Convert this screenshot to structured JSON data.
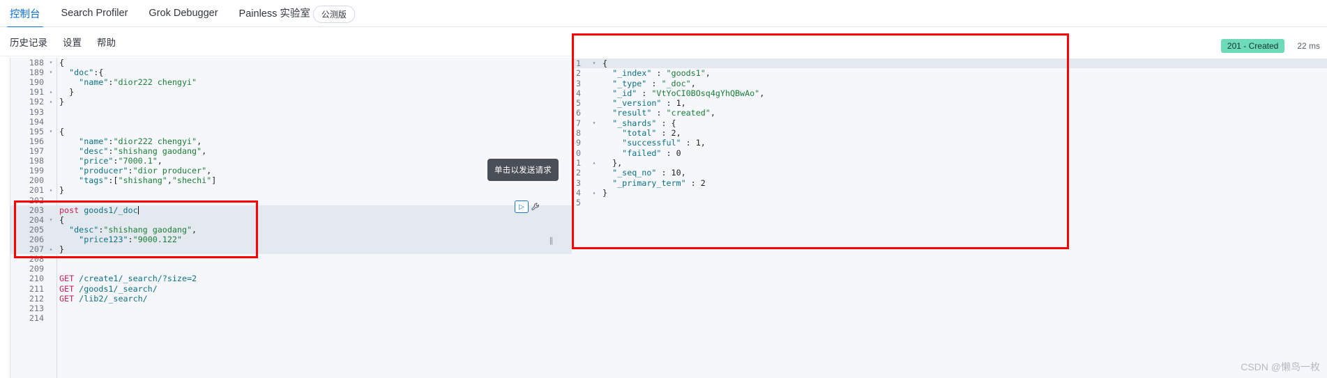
{
  "topbar": {
    "tabs": [
      {
        "label": "控制台",
        "active": true
      },
      {
        "label": "Search Profiler",
        "active": false
      },
      {
        "label": "Grok Debugger",
        "active": false
      },
      {
        "label": "Painless 实验室",
        "active": false
      }
    ],
    "beta_badge": "公测版"
  },
  "submenu": {
    "items": [
      {
        "label": "历史记录"
      },
      {
        "label": "设置"
      },
      {
        "label": "帮助"
      }
    ]
  },
  "editor": {
    "lines": [
      {
        "n": "188",
        "fold": "▾",
        "error": false,
        "hl": false,
        "text": "{"
      },
      {
        "n": "189",
        "fold": "▾",
        "error": false,
        "hl": false,
        "text": "  \"doc\":{"
      },
      {
        "n": "190",
        "fold": "",
        "error": false,
        "hl": false,
        "text": "    \"name\":\"dior222 chengyi\""
      },
      {
        "n": "191",
        "fold": "▴",
        "error": false,
        "hl": false,
        "text": "  }"
      },
      {
        "n": "192",
        "fold": "▴",
        "error": false,
        "hl": false,
        "text": "}"
      },
      {
        "n": "193",
        "fold": "",
        "error": false,
        "hl": false,
        "text": ""
      },
      {
        "n": "194",
        "fold": "",
        "error": false,
        "hl": false,
        "text": ""
      },
      {
        "n": "195",
        "fold": "▾",
        "error": true,
        "hl": false,
        "text": "{"
      },
      {
        "n": "196",
        "fold": "",
        "error": false,
        "hl": false,
        "text": "    \"name\":\"dior222 chengyi\","
      },
      {
        "n": "197",
        "fold": "",
        "error": false,
        "hl": false,
        "text": "    \"desc\":\"shishang gaodang\","
      },
      {
        "n": "198",
        "fold": "",
        "error": false,
        "hl": false,
        "text": "    \"price\":\"7000.1\","
      },
      {
        "n": "199",
        "fold": "",
        "error": false,
        "hl": false,
        "text": "    \"producer\":\"dior producer\","
      },
      {
        "n": "200",
        "fold": "",
        "error": false,
        "hl": false,
        "text": "    \"tags\":[\"shishang\",\"shechi\"]"
      },
      {
        "n": "201",
        "fold": "▴",
        "error": false,
        "hl": false,
        "text": "}"
      },
      {
        "n": "202",
        "fold": "",
        "error": false,
        "hl": false,
        "text": ""
      },
      {
        "n": "203",
        "fold": "",
        "error": false,
        "hl": true,
        "text": "post goods1/_doc"
      },
      {
        "n": "204",
        "fold": "▾",
        "error": false,
        "hl": true,
        "text": "{"
      },
      {
        "n": "205",
        "fold": "",
        "error": false,
        "hl": true,
        "text": "  \"desc\":\"shishang gaodang\","
      },
      {
        "n": "206",
        "fold": "",
        "error": false,
        "hl": true,
        "text": "    \"price123\":\"9000.122\""
      },
      {
        "n": "207",
        "fold": "▴",
        "error": false,
        "hl": true,
        "text": "}"
      },
      {
        "n": "208",
        "fold": "",
        "error": false,
        "hl": false,
        "text": ""
      },
      {
        "n": "209",
        "fold": "",
        "error": false,
        "hl": false,
        "text": ""
      },
      {
        "n": "210",
        "fold": "",
        "error": false,
        "hl": false,
        "text": "GET /create1/_search/?size=2"
      },
      {
        "n": "211",
        "fold": "",
        "error": false,
        "hl": false,
        "text": "GET /goods1/_search/"
      },
      {
        "n": "212",
        "fold": "",
        "error": false,
        "hl": false,
        "text": "GET /lib2/_search/"
      },
      {
        "n": "213",
        "fold": "",
        "error": false,
        "hl": false,
        "text": ""
      },
      {
        "n": "214",
        "fold": "",
        "error": false,
        "hl": false,
        "text": ""
      }
    ],
    "cursor_line": "203"
  },
  "tooltip": {
    "text": "单击以发送请求"
  },
  "icons": {
    "play": "▷",
    "wrench": "🔧",
    "splitter": "||",
    "error_marker": "✖"
  },
  "response": {
    "status_badge": "201 - Created",
    "time": "22 ms",
    "lines": [
      {
        "n": "1",
        "fold": "▾",
        "hl": true,
        "text": "{"
      },
      {
        "n": "2",
        "fold": "",
        "hl": false,
        "text": "  \"_index\" : \"goods1\","
      },
      {
        "n": "3",
        "fold": "",
        "hl": false,
        "text": "  \"_type\" : \"_doc\","
      },
      {
        "n": "4",
        "fold": "",
        "hl": false,
        "text": "  \"_id\" : \"VtYoCI0BOsq4gYhQBwAo\","
      },
      {
        "n": "5",
        "fold": "",
        "hl": false,
        "text": "  \"_version\" : 1,"
      },
      {
        "n": "6",
        "fold": "",
        "hl": false,
        "text": "  \"result\" : \"created\","
      },
      {
        "n": "7",
        "fold": "▾",
        "hl": false,
        "text": "  \"_shards\" : {"
      },
      {
        "n": "8",
        "fold": "",
        "hl": false,
        "text": "    \"total\" : 2,"
      },
      {
        "n": "9",
        "fold": "",
        "hl": false,
        "text": "    \"successful\" : 1,"
      },
      {
        "n": "0",
        "fold": "",
        "hl": false,
        "text": "    \"failed\" : 0"
      },
      {
        "n": "1",
        "fold": "▴",
        "hl": false,
        "text": "  },"
      },
      {
        "n": "2",
        "fold": "",
        "hl": false,
        "text": "  \"_seq_no\" : 10,"
      },
      {
        "n": "3",
        "fold": "",
        "hl": false,
        "text": "  \"_primary_term\" : 2"
      },
      {
        "n": "4",
        "fold": "▴",
        "hl": false,
        "text": "}"
      },
      {
        "n": "5",
        "fold": "",
        "hl": false,
        "text": ""
      }
    ]
  },
  "watermark": {
    "text": "CSDN @懒鸟一枚"
  },
  "colors": {
    "accent": "#0a6edc",
    "status_green": "#6ddbb8",
    "annotation_red": "#ff0000",
    "method": "#c72255",
    "string": "#1a7f37",
    "key": "#0b7285"
  }
}
